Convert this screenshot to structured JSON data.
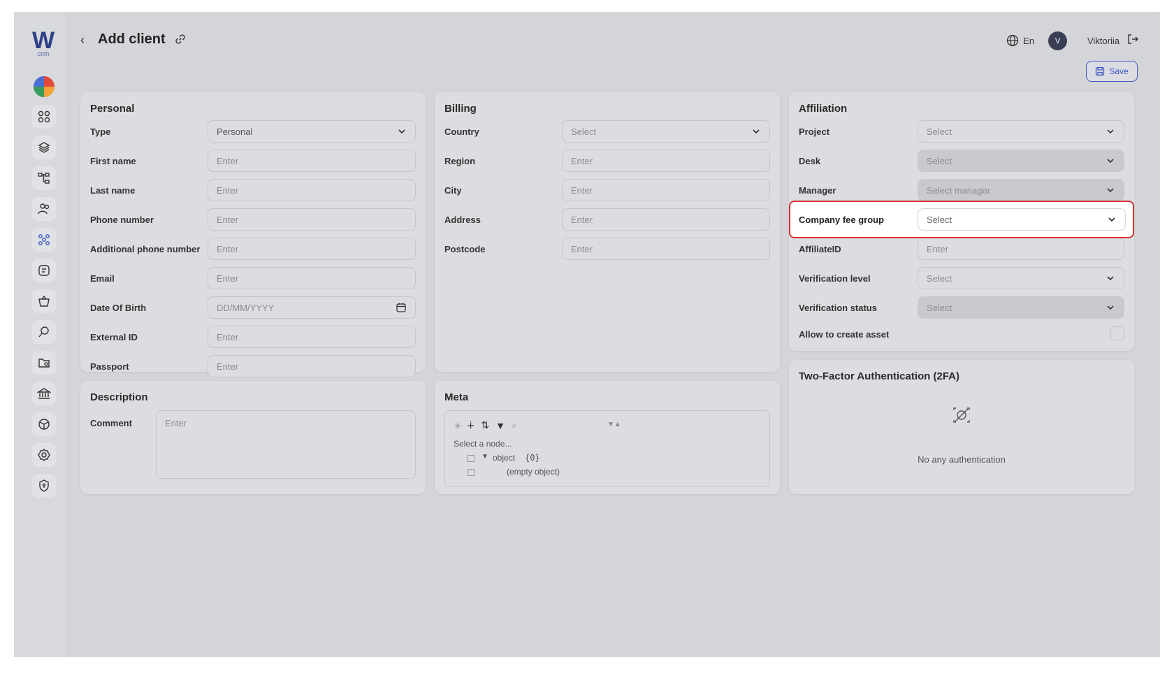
{
  "app": {
    "logo_letter": "W",
    "logo_sub": "crm"
  },
  "header": {
    "title": "Add client",
    "language": "En",
    "user_initial": "V",
    "user_name": "Viktoriia",
    "save_label": "Save"
  },
  "personal": {
    "title": "Personal",
    "fields": [
      {
        "label": "Type",
        "value": "Personal",
        "kind": "select"
      },
      {
        "label": "First name",
        "value": "Enter",
        "kind": "input"
      },
      {
        "label": "Last name",
        "value": "Enter",
        "kind": "input"
      },
      {
        "label": "Phone number",
        "value": "Enter",
        "kind": "input"
      },
      {
        "label": "Additional phone number",
        "value": "Enter",
        "kind": "input"
      },
      {
        "label": "Email",
        "value": "Enter",
        "kind": "input"
      },
      {
        "label": "Date Of Birth",
        "value": "DD/MM/YYYY",
        "kind": "date"
      },
      {
        "label": "External ID",
        "value": "Enter",
        "kind": "input"
      },
      {
        "label": "Passport",
        "value": "Enter",
        "kind": "input"
      }
    ]
  },
  "billing": {
    "title": "Billing",
    "fields": [
      {
        "label": "Country",
        "value": "Select",
        "kind": "select"
      },
      {
        "label": "Region",
        "value": "Enter",
        "kind": "input"
      },
      {
        "label": "City",
        "value": "Enter",
        "kind": "input"
      },
      {
        "label": "Address",
        "value": "Enter",
        "kind": "input"
      },
      {
        "label": "Postcode",
        "value": "Enter",
        "kind": "input"
      }
    ]
  },
  "affiliation": {
    "title": "Affiliation",
    "fields": [
      {
        "label": "Project",
        "value": "Select",
        "kind": "select"
      },
      {
        "label": "Desk",
        "value": "Select",
        "kind": "select-disabled"
      },
      {
        "label": "Manager",
        "value": "Select manager",
        "kind": "select-disabled"
      },
      {
        "label": "Company fee group",
        "value": "Select",
        "kind": "select-highlight"
      },
      {
        "label": "AffiliateID",
        "value": "Enter",
        "kind": "input"
      },
      {
        "label": "Verification level",
        "value": "Select",
        "kind": "select"
      },
      {
        "label": "Verification status",
        "value": "Select",
        "kind": "select-disabled"
      }
    ],
    "allow_asset_label": "Allow to create asset"
  },
  "description": {
    "title": "Description",
    "comment_label": "Comment",
    "comment_placeholder": "Enter"
  },
  "meta": {
    "title": "Meta",
    "select_node": "Select a node...",
    "object_label": "object",
    "object_count": "{0}",
    "empty_object": "(empty object)"
  },
  "tfa": {
    "title": "Two-Factor Authentication (2FA)",
    "empty_text": "No any authentication"
  },
  "colors": {
    "accent": "#3c59c8",
    "highlight": "#d93030"
  }
}
